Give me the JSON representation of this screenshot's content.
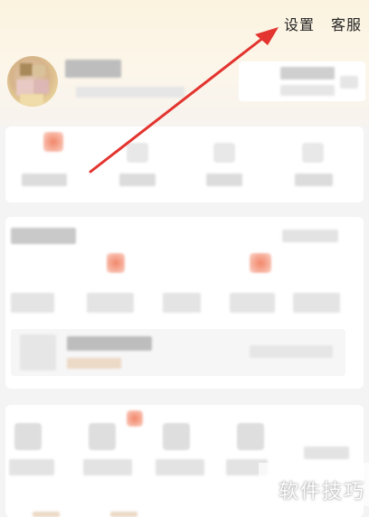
{
  "topbar": {
    "settings_label": "设置",
    "service_label": "客服"
  },
  "watermark": {
    "text": "软件技巧"
  },
  "colors": {
    "accent_red": "#e3342f",
    "header_top": "#fbf3df"
  },
  "icons": {
    "annotation": "red-arrow"
  }
}
